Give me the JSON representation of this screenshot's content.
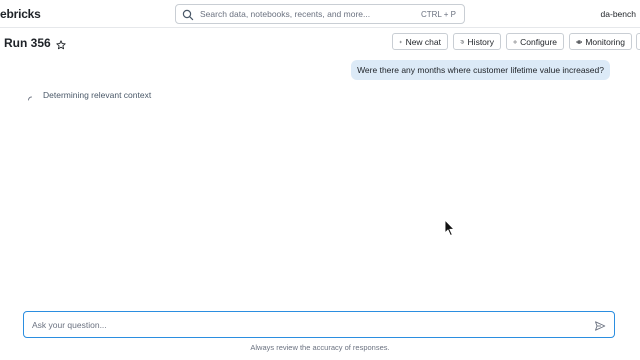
{
  "topbar": {
    "brand": "ebricks",
    "search_placeholder": "Search data, notebooks, recents, and more...",
    "search_shortcut": "CTRL + P",
    "workspace": "da-bench"
  },
  "header": {
    "title": "Run 356",
    "buttons": {
      "new_chat": "New chat",
      "history": "History",
      "configure": "Configure",
      "monitoring": "Monitoring"
    }
  },
  "conversation": {
    "user_message": "Were there any months where customer lifetime value increased?",
    "status": "Determining relevant context"
  },
  "composer": {
    "placeholder": "Ask your question...",
    "disclaimer": "Always review the accuracy of responses."
  },
  "colors": {
    "accent": "#2b8ee0",
    "user_bubble": "#dceaf7",
    "border": "#c9ced4"
  },
  "icons": [
    "search-icon",
    "star-icon",
    "plus-icon",
    "history-icon",
    "gear-icon",
    "eye-icon",
    "spinner-icon",
    "send-icon",
    "mouse-cursor-icon"
  ]
}
